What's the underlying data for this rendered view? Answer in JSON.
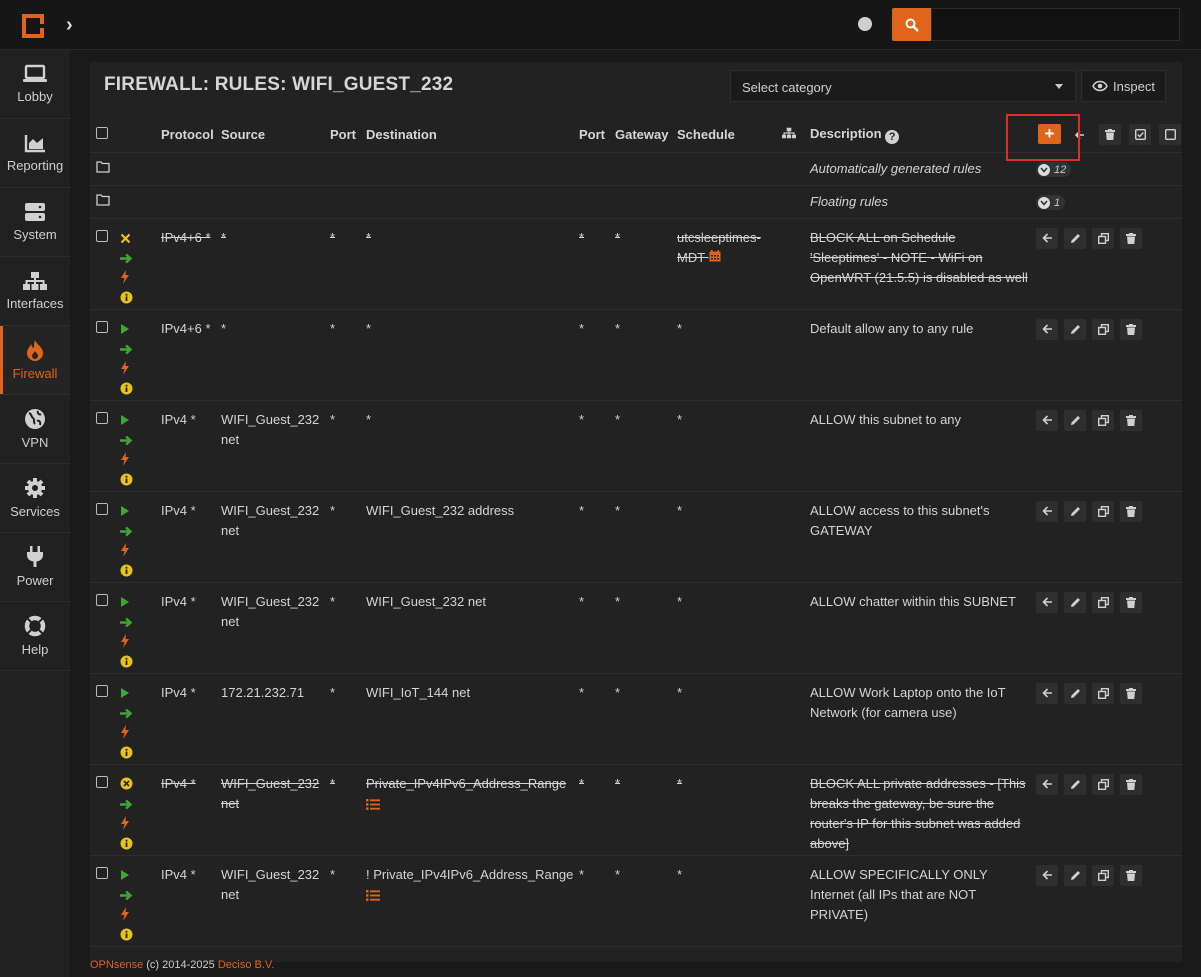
{
  "topbar": {
    "search_placeholder": ""
  },
  "sidebar": {
    "items": [
      {
        "label": "Lobby"
      },
      {
        "label": "Reporting"
      },
      {
        "label": "System"
      },
      {
        "label": "Interfaces"
      },
      {
        "label": "Firewall"
      },
      {
        "label": "VPN"
      },
      {
        "label": "Services"
      },
      {
        "label": "Power"
      },
      {
        "label": "Help"
      }
    ]
  },
  "header": {
    "title": "FIREWALL: RULES: WIFI_GUEST_232",
    "category_select": "Select category",
    "inspect_label": "Inspect"
  },
  "table": {
    "columns": {
      "protocol": "Protocol",
      "source": "Source",
      "port": "Port",
      "destination": "Destination",
      "port2": "Port",
      "gateway": "Gateway",
      "schedule": "Schedule",
      "description": "Description"
    },
    "folders": [
      {
        "label": "Automatically generated rules",
        "count": "12"
      },
      {
        "label": "Floating rules",
        "count": "1"
      }
    ],
    "rules": [
      {
        "protocol": "IPv4+6 *",
        "source": "*",
        "src_port": "*",
        "destination": "*",
        "dst_port": "*",
        "gateway": "*",
        "schedule": "utcsleeptimes-MDT",
        "description": "BLOCK ALL on Schedule 'Sleeptimes' - NOTE - WiFi on OpenWRT (21.5.5) is disabled as well"
      },
      {
        "protocol": "IPv4+6 *",
        "source": "*",
        "src_port": "*",
        "destination": "*",
        "dst_port": "*",
        "gateway": "*",
        "schedule": "*",
        "description": "Default allow any to any rule"
      },
      {
        "protocol": "IPv4 *",
        "source": "WIFI_Guest_232 net",
        "src_port": "*",
        "destination": "*",
        "dst_port": "*",
        "gateway": "*",
        "schedule": "*",
        "description": "ALLOW this subnet to any"
      },
      {
        "protocol": "IPv4 *",
        "source": "WIFI_Guest_232 net",
        "src_port": "*",
        "destination": "WIFI_Guest_232 address",
        "dst_port": "*",
        "gateway": "*",
        "schedule": "*",
        "description": "ALLOW access to this subnet's GATEWAY"
      },
      {
        "protocol": "IPv4 *",
        "source": "WIFI_Guest_232 net",
        "src_port": "*",
        "destination": "WIFI_Guest_232 net",
        "dst_port": "*",
        "gateway": "*",
        "schedule": "*",
        "description": "ALLOW chatter within this SUBNET"
      },
      {
        "protocol": "IPv4 *",
        "source": "172.21.232.71",
        "src_port": "*",
        "destination": "WIFI_IoT_144 net",
        "dst_port": "*",
        "gateway": "*",
        "schedule": "*",
        "description": "ALLOW Work Laptop onto the IoT Network (for camera use)"
      },
      {
        "protocol": "IPv4 *",
        "source": "WIFI_Guest_232 net",
        "src_port": "*",
        "destination": "Private_IPv4IPv6_Address_Range",
        "dst_port": "*",
        "gateway": "*",
        "schedule": "*",
        "description": "BLOCK ALL private addresses - [This breaks the gateway, be sure the router's IP for this subnet was added above]"
      },
      {
        "protocol": "IPv4 *",
        "source": "WIFI_Guest_232 net",
        "src_port": "*",
        "destination": "! Private_IPv4IPv6_Address_Range",
        "dst_port": "*",
        "gateway": "*",
        "schedule": "*",
        "description": "ALLOW SPECIFICALLY ONLY Internet (all IPs that are NOT PRIVATE)"
      }
    ]
  },
  "footer": {
    "brand": "OPNsense",
    "copy": "(c) 2014-2025",
    "company": "Deciso B.V."
  },
  "colors": {
    "accent": "#e0641c",
    "green": "#3fa535",
    "yellow": "#e8c21c"
  }
}
